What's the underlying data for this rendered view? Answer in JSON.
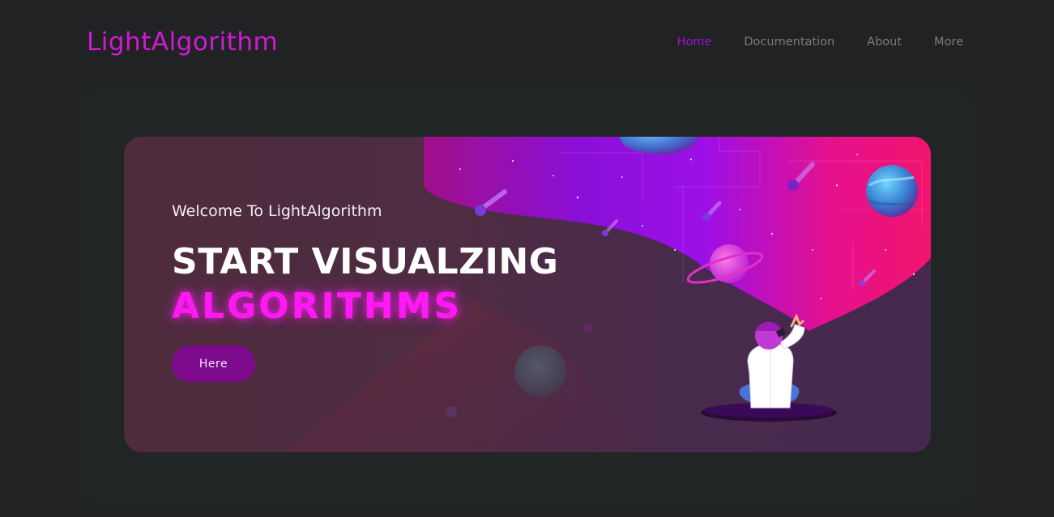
{
  "navbar": {
    "brand": "LightAlgorithm",
    "links": [
      {
        "label": "Home",
        "active": true
      },
      {
        "label": "Documentation",
        "active": false
      },
      {
        "label": "About",
        "active": false
      },
      {
        "label": "More",
        "active": false
      }
    ]
  },
  "hero": {
    "welcome": "Welcome To LightAlgorithm",
    "title_line1": "START VISUALZING",
    "title_line2": "ALGORITHMS",
    "button_label": "Here"
  },
  "colors": {
    "brand": "#d21ad6",
    "nav_active": "#a012d8",
    "nav_inactive": "#7b7d80",
    "accent_glow": "#ff19f4",
    "button": "#7e0a8e",
    "background": "#202223"
  },
  "icons": [
    "space-illustration-icon",
    "planet-icon",
    "comet-icon",
    "person-with-telescope-icon"
  ]
}
